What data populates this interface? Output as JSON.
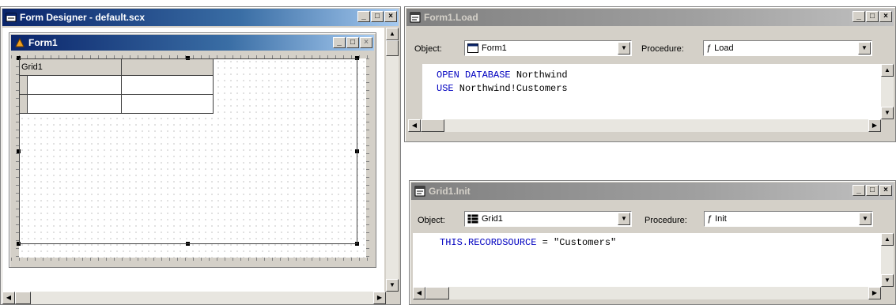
{
  "form_designer": {
    "title": "Form Designer - default.scx",
    "form_title": "Form1",
    "grid_caption": "Grid1",
    "window_buttons": [
      "_",
      "□",
      "×"
    ]
  },
  "load_window": {
    "title": "Form1.Load",
    "object_label": "Object:",
    "object_value": "Form1",
    "procedure_label": "Procedure:",
    "procedure_value": "Load",
    "code_lines": [
      {
        "kw": "OPEN DATABASE",
        "rest": " Northwind"
      },
      {
        "kw": "USE",
        "rest": " Northwind!Customers"
      }
    ]
  },
  "init_window": {
    "title": "Grid1.Init",
    "object_label": "Object:",
    "object_value": "Grid1",
    "procedure_label": "Procedure:",
    "procedure_value": "Init",
    "code_lines": [
      {
        "kw": "THIS.RECORDSOURCE",
        "rest": " = \"Customers\""
      }
    ]
  },
  "colors": {
    "active_title": "#0a246a",
    "inactive_title": "#808080",
    "keyword": "#0000c0",
    "face": "#d4d0c8"
  },
  "icons": [
    "form-icon",
    "code-window-icon",
    "grid-icon",
    "lightning-icon"
  ]
}
